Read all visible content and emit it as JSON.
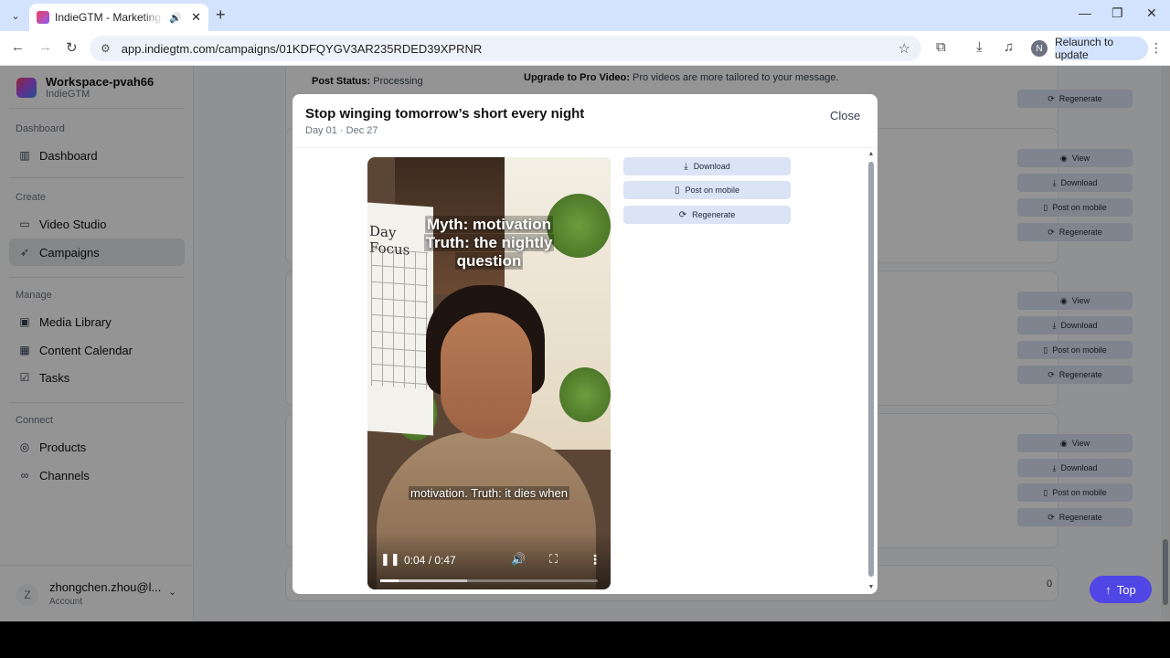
{
  "browser": {
    "tab_title": "IndieGTM - Marketing OS f",
    "url": "app.indiegtm.com/campaigns/01KDFQYGV3AR235RDED39XPRNR",
    "relaunch_label": "Relaunch to update",
    "profile_initial": "N"
  },
  "sidebar": {
    "workspace_name": "Workspace-pvah66",
    "workspace_sub": "IndieGTM",
    "sections": {
      "dashboard": "Dashboard",
      "create": "Create",
      "manage": "Manage",
      "connect": "Connect"
    },
    "items": [
      {
        "label": "Dashboard",
        "icon": "bar-chart-icon"
      },
      {
        "label": "Video Studio",
        "icon": "video-icon"
      },
      {
        "label": "Campaigns",
        "icon": "rocket-icon"
      },
      {
        "label": "Media Library",
        "icon": "image-icon"
      },
      {
        "label": "Content Calendar",
        "icon": "calendar-icon"
      },
      {
        "label": "Tasks",
        "icon": "checklist-icon"
      },
      {
        "label": "Products",
        "icon": "products-icon"
      },
      {
        "label": "Channels",
        "icon": "link-icon"
      }
    ],
    "user": {
      "initial": "Z",
      "name": "zhongchen.zhou@l...",
      "role": "Account"
    }
  },
  "background": {
    "post_status_label": "Post Status:",
    "post_status_value": "Processing",
    "upgrade_label": "Upgrade to Pro Video:",
    "upgrade_text": "Pro videos are more tailored to your message.",
    "actions": {
      "view": "View",
      "download": "Download",
      "post_on_mobile": "Post on mobile",
      "regenerate": "Regenerate"
    },
    "count": "0",
    "top_button": "Top"
  },
  "modal": {
    "title": "Stop winging tomorrow’s short every night",
    "subtitle": "Day 01 · Dec 27",
    "close_label": "Close",
    "video": {
      "calendar_text": "Day Focus",
      "caption_top_1": "Myth: motivation",
      "caption_top_2": "Truth: the nightly",
      "caption_top_3": "question",
      "caption_bottom": "motivation. Truth: it dies when",
      "time": "0:04 / 0:47",
      "progress": 0.085
    },
    "buttons": {
      "download": "Download",
      "post_on_mobile": "Post on mobile",
      "regenerate": "Regenerate"
    }
  }
}
